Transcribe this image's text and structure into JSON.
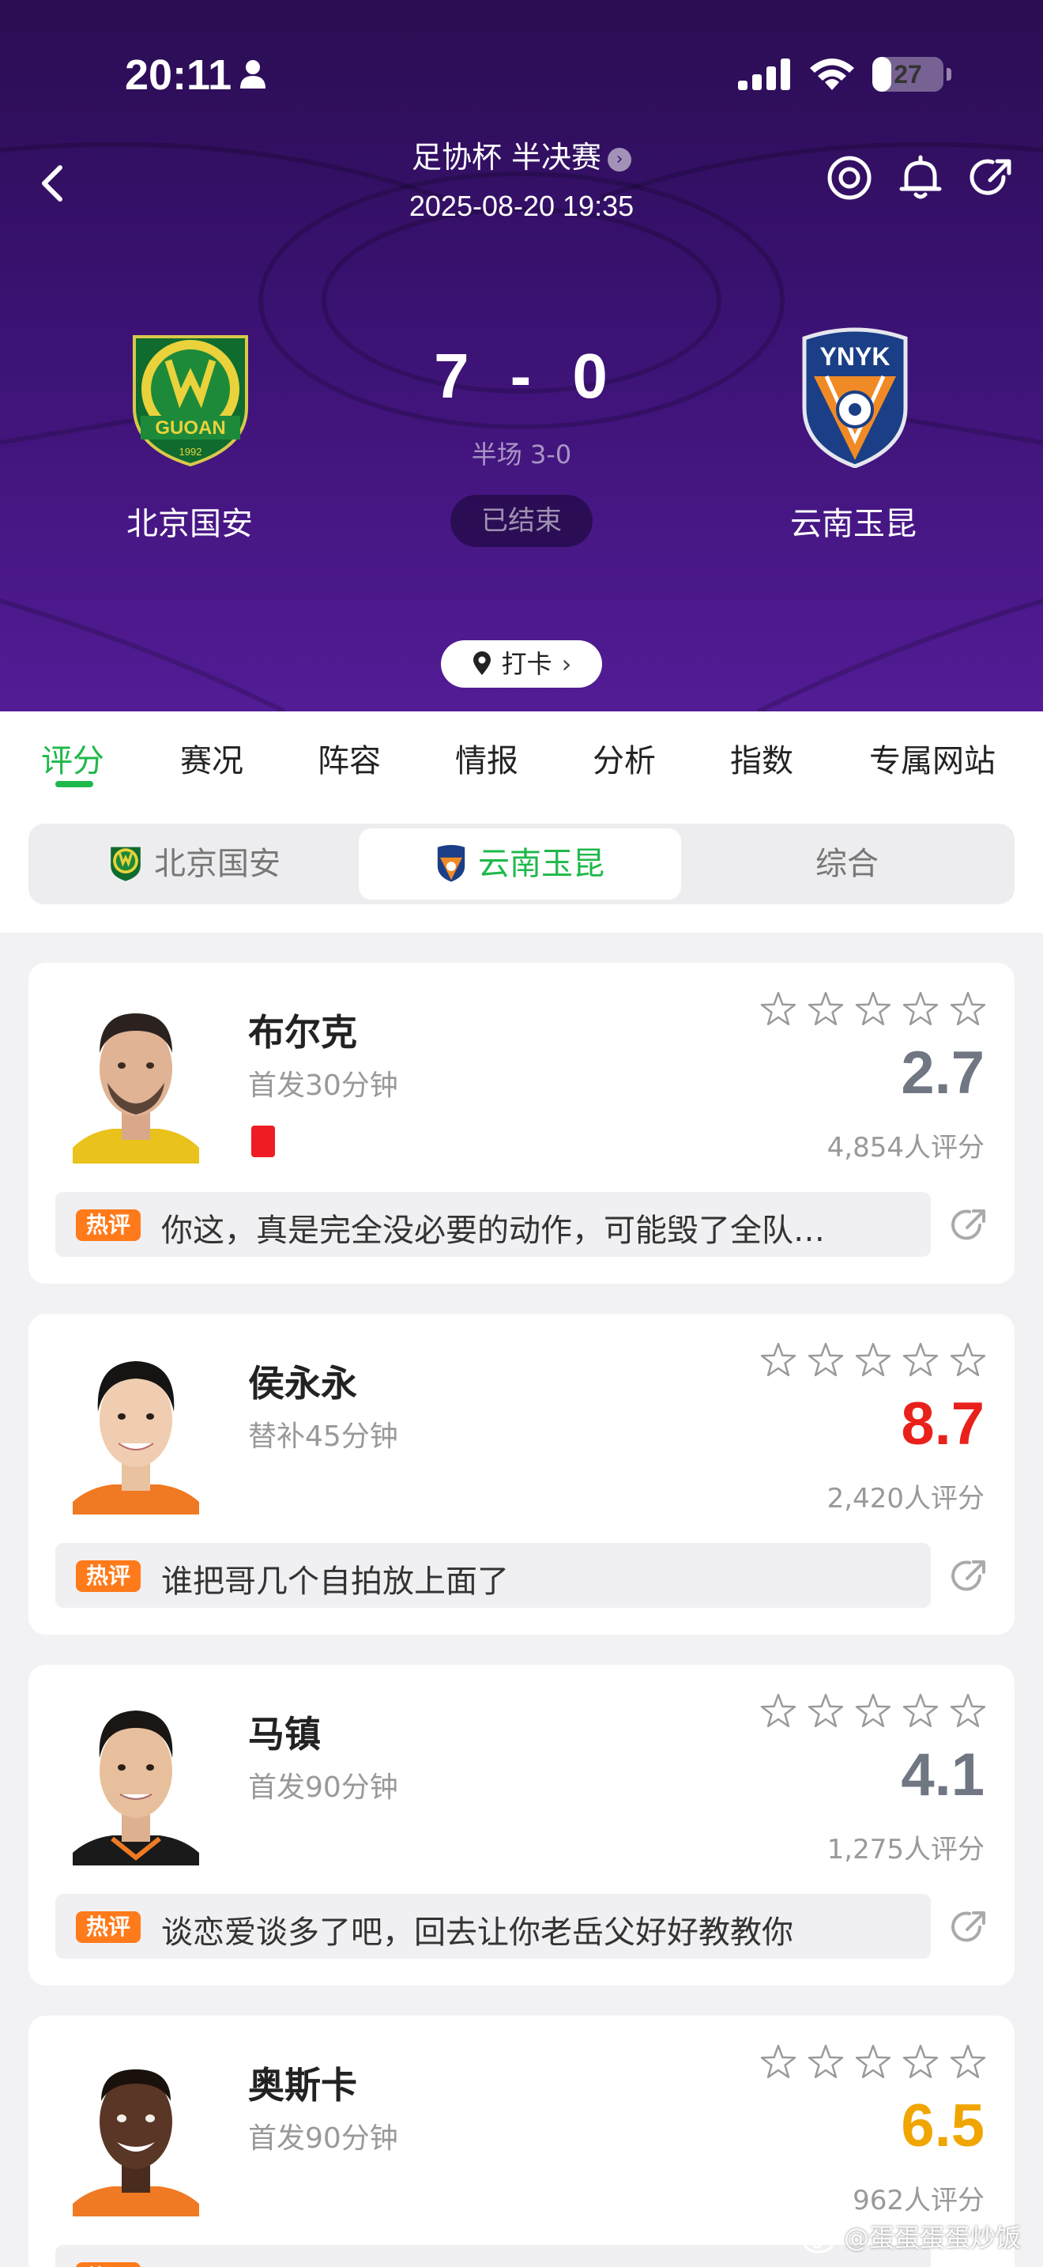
{
  "status_bar": {
    "time": "20:11",
    "battery": "27",
    "battery_level": 0.27
  },
  "match": {
    "competition": "足协杯 半决赛",
    "datetime": "2025-08-20 19:35",
    "home_team": "北京国安",
    "away_team": "云南玉昆",
    "home_score": "7",
    "away_score": "0",
    "score_separator": "-",
    "halftime": "半场 3-0",
    "status": "已结束",
    "checkin_label": "打卡",
    "home_logo_text": "GUOAN",
    "home_logo_year": "1992",
    "away_logo_text": "YNYK"
  },
  "tabs": [
    {
      "label": "评分",
      "active": true
    },
    {
      "label": "赛况"
    },
    {
      "label": "阵容"
    },
    {
      "label": "情报"
    },
    {
      "label": "分析"
    },
    {
      "label": "指数"
    },
    {
      "label": "专属网站"
    }
  ],
  "team_switch": [
    {
      "label": "北京国安"
    },
    {
      "label": "云南玉昆",
      "active": true
    },
    {
      "label": "综合"
    }
  ],
  "hot_label": "热评",
  "players": [
    {
      "name": "布尔克",
      "time": "首发30分钟",
      "rating": "2.7",
      "rating_color": "#707783",
      "count": "4,854人评分",
      "red_card": true,
      "comment": "你这，真是完全没必要的动作，可能毁了全队…"
    },
    {
      "name": "侯永永",
      "time": "替补45分钟",
      "rating": "8.7",
      "rating_color": "#e8221b",
      "count": "2,420人评分",
      "red_card": false,
      "comment": "谁把哥几个自拍放上面了"
    },
    {
      "name": "马镇",
      "time": "首发90分钟",
      "rating": "4.1",
      "rating_color": "#707783",
      "count": "1,275人评分",
      "red_card": false,
      "comment": "谈恋爱谈多了吧，回去让你老岳父好好教教你"
    },
    {
      "name": "奥斯卡",
      "time": "首发90分钟",
      "rating": "6.5",
      "rating_color": "#f0a500",
      "count": "962人评分",
      "red_card": false,
      "comment": ""
    }
  ],
  "watermark": "@蛋蛋蛋蛋炒饭",
  "colors": {
    "header_top": "#2a0d52",
    "header_bottom": "#521c95",
    "accent_green": "#1fb84a",
    "hot_tag": "#ff7a1a"
  }
}
